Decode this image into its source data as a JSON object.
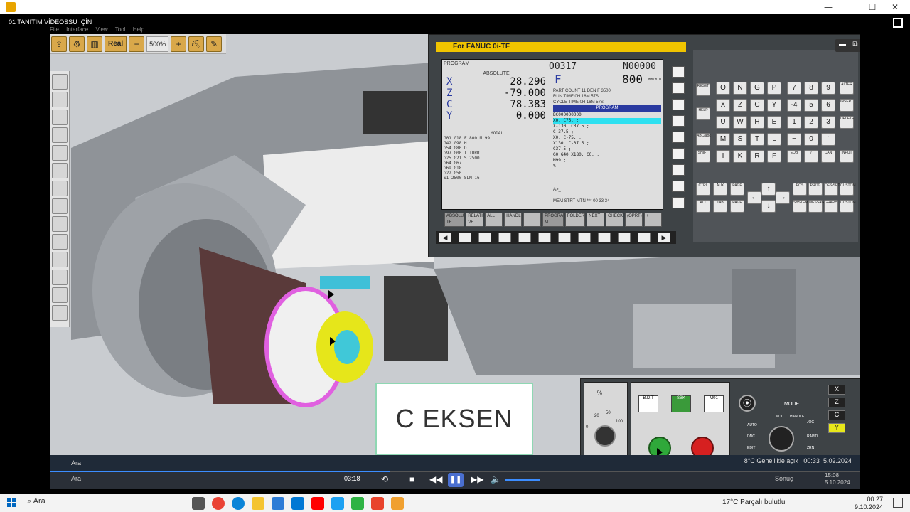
{
  "window": {
    "title": "",
    "controls": [
      "—",
      "☐",
      "✕"
    ]
  },
  "video": {
    "title": "01 TANITIM VİDEOSSU İÇİN",
    "menu": [
      "File",
      "Interface",
      "View",
      "Tool",
      "Help"
    ]
  },
  "toolbar": {
    "real_label": "Real",
    "zoom_label": "500%",
    "minus": "−",
    "plus": "+"
  },
  "cnc": {
    "header": "For FANUC 0i-TF",
    "program_label": "PROGRAM",
    "onum": "O0317",
    "nnum": "N00000",
    "absolute_label": "ABSOLUTE",
    "axes": [
      {
        "axis": "X",
        "value": "28.296"
      },
      {
        "axis": "Z",
        "value": "-79.000"
      },
      {
        "axis": "C",
        "value": "78.383"
      },
      {
        "axis": "Y",
        "value": "0.000"
      }
    ],
    "feed": {
      "label": "F",
      "value": "800",
      "unit": "MM/MIN"
    },
    "status": [
      "PART COUNT   11  DEN F   3500",
      "RUN TIME      0H  16M  57S",
      "CYCLE TIME    0H  16M  57S"
    ],
    "program_title": "PROGRAM",
    "program_lines": [
      {
        "text": "BC000000000",
        "highlight": false
      },
      {
        "text": "X0. C75. ;",
        "highlight": true
      },
      {
        "text": "X-130. C37.5 ;",
        "highlight": false
      },
      {
        "text": "C-37.5 ;",
        "highlight": false
      },
      {
        "text": "X0. C-75. ;",
        "highlight": false
      },
      {
        "text": "X130. C-37.5 ;",
        "highlight": false
      },
      {
        "text": "C37.5 ;",
        "highlight": false
      },
      {
        "text": "G0 G40 X180. C0. ;",
        "highlight": false
      },
      {
        "text": "M99 ;",
        "highlight": false
      },
      {
        "text": "%",
        "highlight": false
      }
    ],
    "modal_title": "MODAL",
    "modal_lines": [
      "G01 G18    F    800  M   99",
      "G42 G98    H",
      "G54 G80    D",
      "G97 G00    T        TURR",
      "G25 G21    S            2500",
      "G64 G67",
      "G69 G18",
      "G22 G50",
      "S1   2500     SLM   16"
    ],
    "input_prompt": "A>_",
    "mem_line": "MEM STRT MTN ***     00 33 34",
    "softkeys": [
      "ABSOLU TE",
      "RELATI VE",
      "ALL",
      "HANDL",
      "",
      "PROGRA M",
      "FOLDER",
      "NEXT",
      "CHECK",
      "(OPRT)",
      "+"
    ],
    "nav_left": "◀",
    "nav_right": "▶"
  },
  "keypad": {
    "left_keys": [
      "RESET",
      "HELP",
      "ABC/abc",
      "SHIFT"
    ],
    "letters": [
      "O",
      "N",
      "G",
      "P",
      "X",
      "Z",
      "C",
      "Y",
      "U",
      "W",
      "H",
      "E",
      "M",
      "S",
      "T",
      "L",
      "I",
      "K",
      "R",
      "F"
    ],
    "numbers": [
      "7",
      "8",
      "9",
      "-4",
      "5",
      "6",
      "1",
      "2",
      "3",
      "−",
      "0",
      "EOB"
    ],
    "right_keys": [
      "CAN",
      "ALTER",
      "INSERT",
      "DELETE",
      "INPUT"
    ],
    "bottom_keys": [
      "CTRL",
      "AUX",
      "PAGE",
      "ALT",
      "TAB",
      "PAGE",
      "POS",
      "PROG",
      "OFS/SET",
      "CUSTOM",
      "SYSTEM",
      "MESSAGE",
      "GRAPH",
      "CUSTOM"
    ]
  },
  "machine_panel": {
    "feed_label": "%",
    "dial_marks": [
      "0",
      "20",
      "50",
      "100"
    ],
    "bdt_label": "B.D.T",
    "sbk_label": "SBK",
    "m01_label": "M01",
    "mode_label": "MODE",
    "mode_options": [
      "AUTO",
      "MDI",
      "HANDLE",
      "JOG",
      "DNC",
      "RAPID",
      "EDIT",
      "ZRN"
    ],
    "axis_buttons": [
      "X",
      "Z",
      "C",
      "Y"
    ]
  },
  "caption": "C EKSEN",
  "inner_taskbar": {
    "search": "Ara",
    "tray": "8°C  Genellikle açık",
    "time": "00:33",
    "date": "5.02.2024"
  },
  "player": {
    "time": "03:18",
    "progress": 0.42,
    "search": "Ara",
    "tray": "Sonuç",
    "time2": "15:08",
    "date2": "5.10.2024"
  },
  "taskbar": {
    "search": "Ara",
    "weather": "17°C  Parçalı bulutlu",
    "time": "00:27",
    "date": "9.10.2024"
  },
  "colors": {
    "accent": "#f0c400",
    "highlight": "#2ee0f0",
    "start_green": "#2fa83a",
    "stop_red": "#d62020",
    "brand_blue": "#0067c0"
  }
}
